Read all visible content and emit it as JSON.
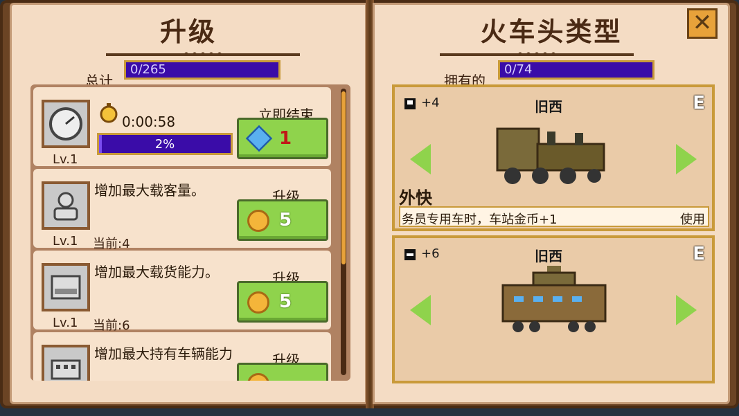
{
  "left": {
    "title": "升级",
    "total_label": "总计",
    "total_value": "0/265",
    "items": [
      {
        "icon": "clock-icon",
        "timer": "0:00:58",
        "progress_text": "2%",
        "progress": 0.02,
        "level": "Lv.1",
        "action_label": "立即结束",
        "cost_icon": "gem-icon",
        "cost": "1"
      },
      {
        "icon": "passenger-icon",
        "desc": "增加最大载客量。",
        "level": "Lv.1",
        "current": "当前:4",
        "action_label": "升级",
        "cost_icon": "coin-icon",
        "cost": "5"
      },
      {
        "icon": "cargo-icon",
        "desc": "增加最大载货能力。",
        "level": "Lv.1",
        "current": "当前:6",
        "action_label": "升级",
        "cost_icon": "coin-icon",
        "cost": "5"
      },
      {
        "icon": "vehicle-icon",
        "desc": "增加最大持有车辆能力",
        "action_label": "升级"
      }
    ]
  },
  "right": {
    "title": "火车头类型",
    "owned_label": "拥有的",
    "owned_value": "0/74",
    "cards": [
      {
        "stat_icon": "passenger-seat-icon",
        "stat": "+4",
        "badge": "旧西",
        "grade": "E",
        "name": "外快",
        "desc": "务员专用车时，车站金币+1",
        "use_label": "使用"
      },
      {
        "stat_icon": "cargo-seat-icon",
        "stat": "+6",
        "badge": "旧西",
        "grade": "E"
      }
    ]
  },
  "close_label": "✕"
}
